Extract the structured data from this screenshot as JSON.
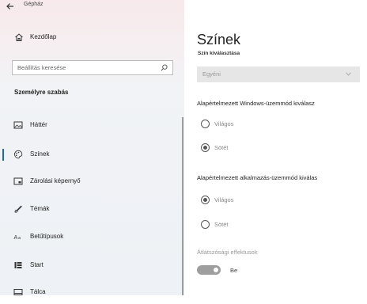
{
  "window": {
    "title": "Gépház"
  },
  "sidebar": {
    "home_label": "Kezdőlap",
    "search_placeholder": "Beállítás keresése",
    "section_title": "Személyre szabás",
    "items": [
      {
        "label": "Háttér",
        "icon": "picture-icon"
      },
      {
        "label": "Színek",
        "icon": "palette-icon",
        "active": true
      },
      {
        "label": "Zárolási képernyő",
        "icon": "lock-screen-icon"
      },
      {
        "label": "Témák",
        "icon": "brush-icon"
      },
      {
        "label": "Betűtípusok",
        "icon": "font-icon"
      },
      {
        "label": "Start",
        "icon": "start-icon"
      },
      {
        "label": "Tálca",
        "icon": "taskbar-icon"
      }
    ]
  },
  "main": {
    "title": "Színek",
    "color_select_label": "Szín kiválasztása",
    "color_select_value": "Egyéni",
    "windows_mode": {
      "title": "Alapértelmezett Windows-üzemmód kiválasz",
      "options": [
        "Világos",
        "Sötét"
      ],
      "selected": "Sötét"
    },
    "app_mode": {
      "title": "Alapértelmezett alkalmazás-üzemmód kiválas",
      "options": [
        "Világos",
        "Sötét"
      ],
      "selected": "Világos"
    },
    "transparency": {
      "label": "Átlátszósági effektusok",
      "state_label": "Be"
    }
  },
  "colors": {
    "accent": "#1f66b8"
  }
}
